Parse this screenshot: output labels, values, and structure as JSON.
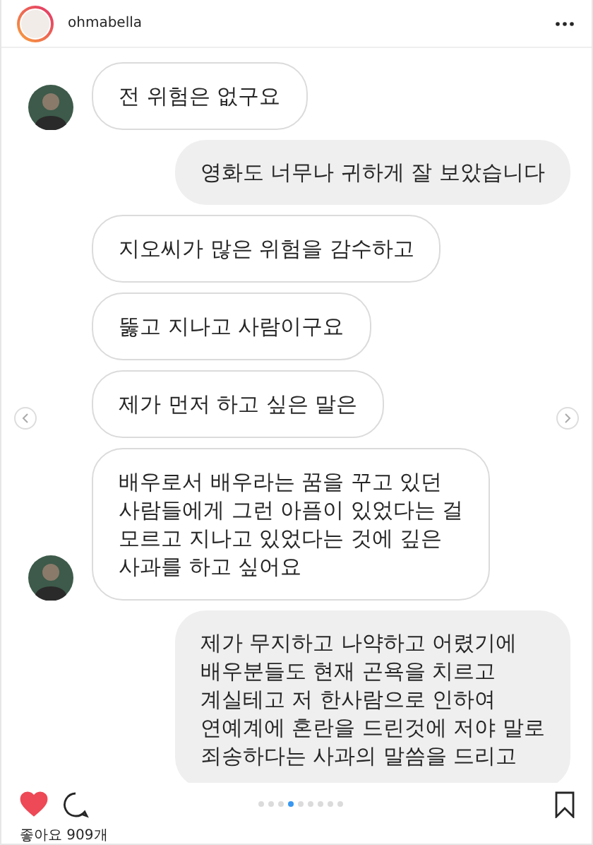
{
  "post": {
    "username": "ohmabella"
  },
  "messages": [
    {
      "kind": "received",
      "avatar": true,
      "text": "전 위험은 없구요"
    },
    {
      "kind": "sent",
      "text": "영화도 너무나 귀하게 잘 보았습니다"
    },
    {
      "kind": "received",
      "avatar": false,
      "text": "지오씨가 많은 위험을 감수하고"
    },
    {
      "kind": "received",
      "avatar": false,
      "text": "뚫고 지나고 사람이구요"
    },
    {
      "kind": "received",
      "avatar": false,
      "text": "제가 먼저 하고 싶은 말은"
    },
    {
      "kind": "received",
      "avatar": true,
      "text": "배우로서 배우라는 꿈을 꾸고 있던\n사람들에게 그런 아픔이 있었다는 걸\n모르고 지나고 있었다는 것에 깊은\n사과를 하고 싶어요"
    },
    {
      "kind": "sent",
      "text": "제가 무지하고 나약하고 어렸기에\n배우분들도 현재 곤욕을 치르고\n계실테고 저 한사람으로 인하여\n연예계에 혼란을 드린것에 저야 말로\n죄송하다는 사과의 말씀을 드리고"
    }
  ],
  "carousel": {
    "dots": [
      {
        "selected": false
      },
      {
        "selected": false
      },
      {
        "selected": false
      },
      {
        "selected": true
      },
      {
        "selected": false
      },
      {
        "selected": false
      },
      {
        "selected": false
      },
      {
        "selected": false
      },
      {
        "selected": false
      }
    ]
  },
  "liked": true,
  "likes": "좋아요 909개"
}
